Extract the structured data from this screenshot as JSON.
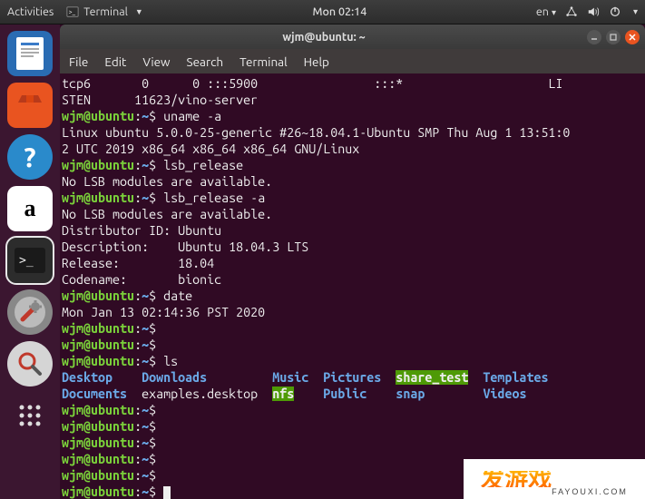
{
  "topbar": {
    "activities": "Activities",
    "app_name": "Terminal",
    "clock": "Mon 02:14",
    "lang": "en"
  },
  "launcher": {
    "items": [
      {
        "name": "libreoffice-writer",
        "glyph": "📄"
      },
      {
        "name": "ubuntu-software",
        "glyph": "🛍"
      },
      {
        "name": "help",
        "glyph": "?"
      },
      {
        "name": "amazon",
        "glyph": "a"
      },
      {
        "name": "terminal",
        "glyph": ">_"
      },
      {
        "name": "settings",
        "glyph": "🔧"
      },
      {
        "name": "search",
        "glyph": "🔍"
      },
      {
        "name": "show-apps",
        "glyph": "⋮⋮⋮"
      }
    ]
  },
  "window": {
    "title": "wjm@ubuntu: ~"
  },
  "menubar": {
    "file": "File",
    "edit": "Edit",
    "view": "View",
    "search": "Search",
    "terminal": "Terminal",
    "help": "Help"
  },
  "term": {
    "netstat_line": "tcp6       0      0 :::5900                :::*                    LI",
    "netstat_line2": "STEN      11623/vino-server",
    "prompt_user": "wjm@ubuntu",
    "prompt_sep": ":",
    "prompt_path": "~",
    "prompt_end": "$ ",
    "cmd_uname": "uname -a",
    "out_uname1": "Linux ubuntu 5.0.0-25-generic #26~18.04.1-Ubuntu SMP Thu Aug 1 13:51:0",
    "out_uname2": "2 UTC 2019 x86_64 x86_64 x86_64 GNU/Linux",
    "cmd_lsb1": "lsb_release",
    "out_nolsb": "No LSB modules are available.",
    "cmd_lsb2": "lsb_release -a",
    "out_distid": "Distributor ID:\tUbuntu",
    "out_desc": "Description:\tUbuntu 18.04.3 LTS",
    "out_rel": "Release:\t18.04",
    "out_code": "Codename:\tbionic",
    "cmd_date": "date",
    "out_date": "Mon Jan 13 02:14:36 PST 2020",
    "cmd_ls": "ls",
    "ls": {
      "desktop": "Desktop",
      "downloads": "Downloads",
      "music": "Music",
      "pictures": "Pictures",
      "share_test": "share_test",
      "templates": "Templates",
      "documents": "Documents",
      "examples": "examples.desktop",
      "nfs": "nfs",
      "public": "Public",
      "snap": "snap",
      "videos": "Videos"
    }
  },
  "watermark": {
    "big": "发游戏",
    "small": "FAYOUXI.COM"
  }
}
